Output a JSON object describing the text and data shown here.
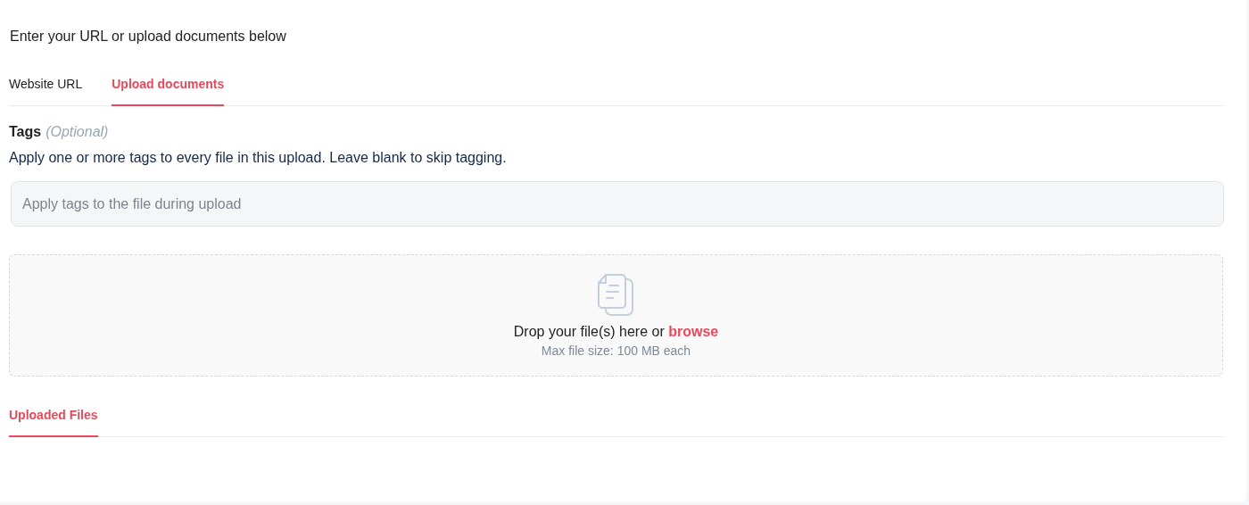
{
  "heading": "Enter your URL or upload documents below",
  "tabs": [
    {
      "label": "Website URL",
      "selected": false
    },
    {
      "label": "Upload documents",
      "selected": true
    }
  ],
  "tags": {
    "label": "Tags",
    "hint": "(Optional)",
    "description": "Apply one or more tags to every file in this upload. Leave blank to skip tagging.",
    "placeholder": "Apply tags to the file during upload"
  },
  "dropzone": {
    "prompt": "Drop your file(s) here or",
    "link": "browse",
    "note": "Max file size: 100 MB each"
  },
  "files_tabs": [
    {
      "label": "Uploaded Files",
      "selected": true
    }
  ]
}
